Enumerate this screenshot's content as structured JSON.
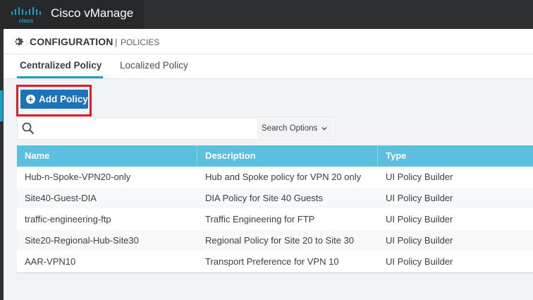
{
  "app": {
    "title": "Cisco vManage",
    "logo_text": "cisco"
  },
  "header": {
    "section": "CONFIGURATION",
    "separator": "|",
    "subsection": "POLICIES"
  },
  "tabs": [
    {
      "label": "Centralized Policy",
      "active": true
    },
    {
      "label": "Localized Policy",
      "active": false
    }
  ],
  "toolbar": {
    "add_label": "Add Policy"
  },
  "search": {
    "placeholder": "",
    "value": "",
    "options_label": "Search Options"
  },
  "table": {
    "columns": [
      "Name",
      "Description",
      "Type"
    ],
    "rows": [
      [
        "Hub-n-Spoke-VPN20-only",
        "Hub and Spoke policy for VPN 20 only",
        "UI Policy Builder"
      ],
      [
        "Site40-Guest-DIA",
        "DIA Policy for Site 40 Guests",
        "UI Policy Builder"
      ],
      [
        "traffic-engineering-ftp",
        "Traffic Engineering for FTP",
        "UI Policy Builder"
      ],
      [
        "Site20-Regional-Hub-Site30",
        "Regional Policy for Site 20 to Site 30",
        "UI Policy Builder"
      ],
      [
        "AAR-VPN10",
        "Transport Preference for VPN 10",
        "UI Policy Builder"
      ]
    ]
  },
  "colors": {
    "accent": "#1ba0c9",
    "button": "#1e73b8",
    "table_header": "#5bc0de",
    "highlight": "#e11b2a",
    "topbar": "#2e2f31"
  },
  "icons": {
    "logo": "cisco-logo-icon",
    "settings": "gear-icon",
    "add": "plus-circle-icon",
    "search": "search-icon",
    "dropdown": "chevron-down-icon"
  }
}
